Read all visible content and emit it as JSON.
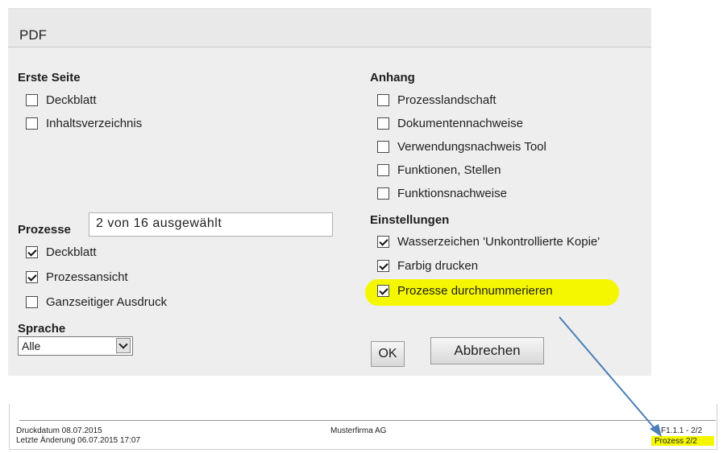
{
  "dialog": {
    "title": "PDF",
    "erste_seite": {
      "heading": "Erste Seite",
      "items": [
        {
          "label": "Deckblatt",
          "checked": false
        },
        {
          "label": "Inhaltsverzeichnis",
          "checked": false
        }
      ]
    },
    "prozesse": {
      "label": "Prozesse",
      "field_value": "2 von 16 ausgewählt",
      "items": [
        {
          "label": "Deckblatt",
          "checked": true
        },
        {
          "label": "Prozessansicht",
          "checked": true
        },
        {
          "label": "Ganzseitiger Ausdruck",
          "checked": false
        }
      ]
    },
    "sprache": {
      "label": "Sprache",
      "selected": "Alle"
    },
    "anhang": {
      "heading": "Anhang",
      "items": [
        {
          "label": "Prozesslandschaft",
          "checked": false
        },
        {
          "label": "Dokumentennachweise",
          "checked": false
        },
        {
          "label": "Verwendungsnachweis Tool",
          "checked": false
        },
        {
          "label": "Funktionen, Stellen",
          "checked": false
        },
        {
          "label": "Funktionsnachweise",
          "checked": false
        }
      ]
    },
    "einstellungen": {
      "heading": "Einstellungen",
      "items": [
        {
          "label": "Wasserzeichen 'Unkontrollierte Kopie'",
          "checked": true
        },
        {
          "label": "Farbig drucken",
          "checked": true
        },
        {
          "label": "Prozesse durchnummerieren",
          "checked": true
        }
      ]
    },
    "buttons": {
      "ok": "OK",
      "cancel": "Abbrechen"
    }
  },
  "footer": {
    "druckdatum": "Druckdatum 08.07.2015",
    "letzte_aenderung": "Letzte Änderung 06.07.2015 17:07",
    "company": "Musterfirma AG",
    "page_ref": "F1.1.1 - 2/2",
    "prozess_count": "Prozess 2/2"
  },
  "colors": {
    "highlight": "#f4f700",
    "arrow": "#4a7fb8",
    "dialog_bg": "#eeeeee"
  }
}
